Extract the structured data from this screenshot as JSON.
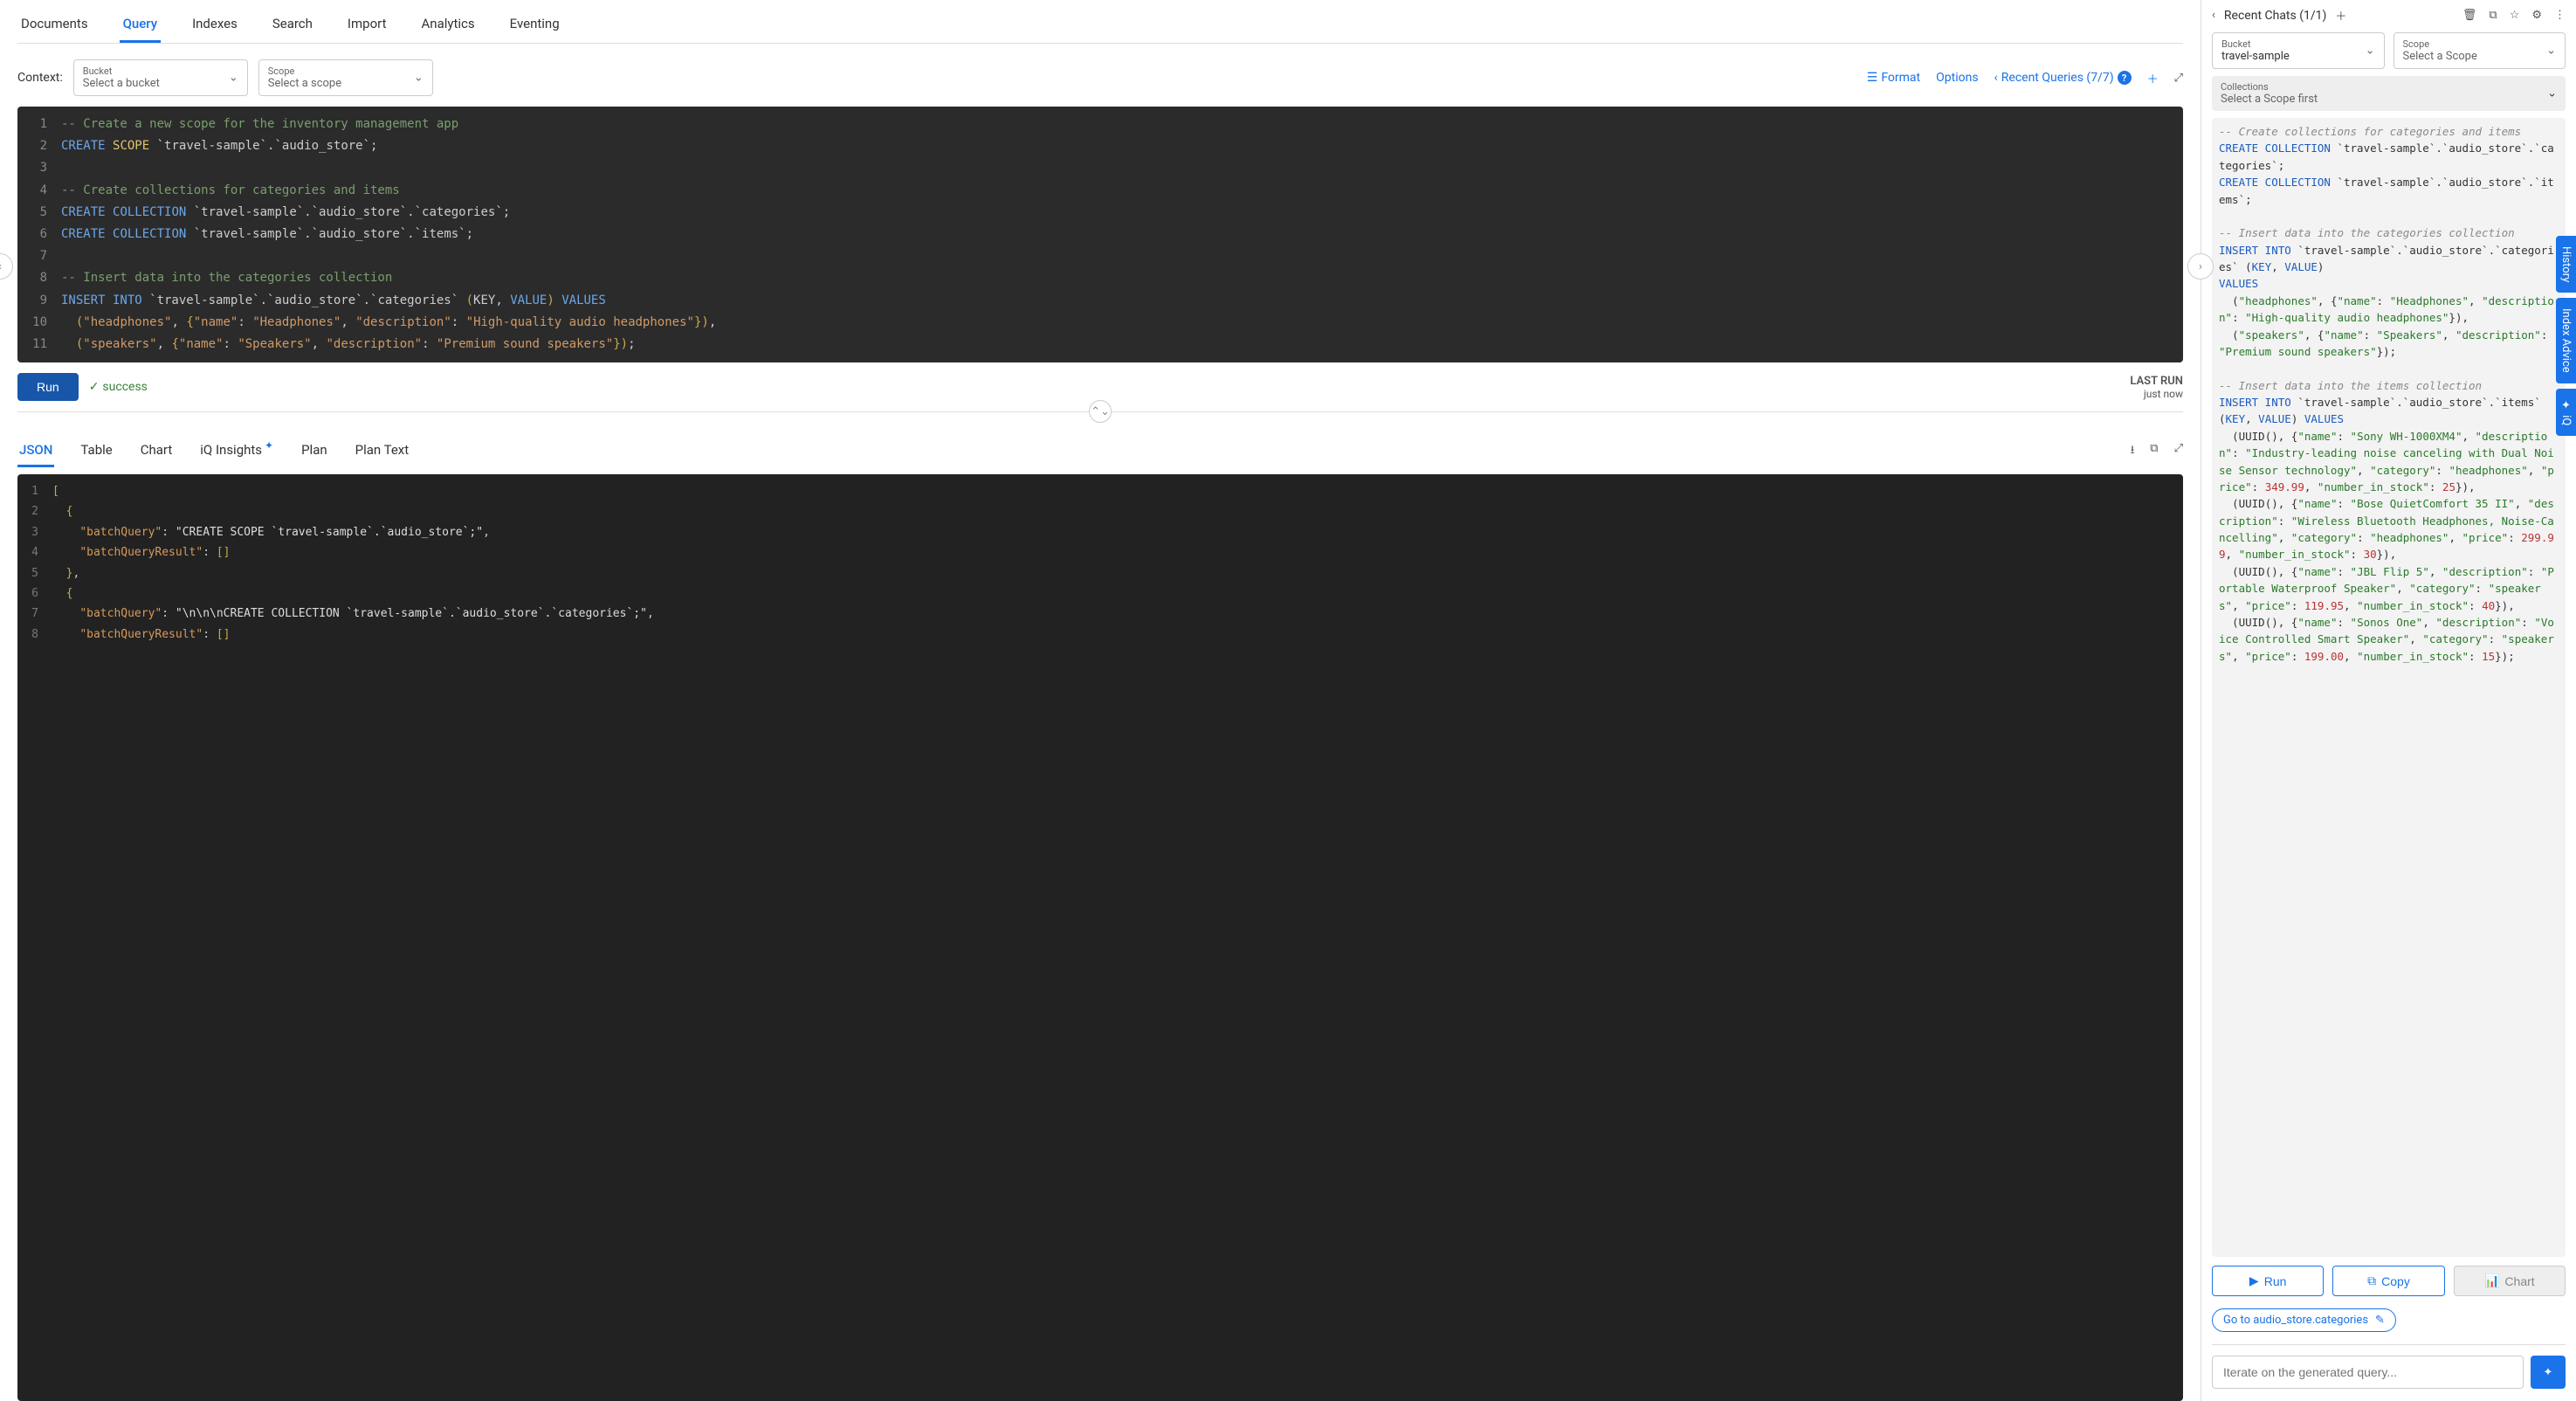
{
  "tabs": [
    "Documents",
    "Query",
    "Indexes",
    "Search",
    "Import",
    "Analytics",
    "Eventing"
  ],
  "activeTab": "Query",
  "context": {
    "label": "Context:",
    "bucket": {
      "label": "Bucket",
      "placeholder": "Select a bucket"
    },
    "scope": {
      "label": "Scope",
      "placeholder": "Select a scope"
    }
  },
  "topActions": {
    "format": "Format",
    "options": "Options",
    "recentQueries": "Recent Queries (7/7)",
    "badge": "?"
  },
  "editorLines": [
    [
      {
        "t": "comment",
        "v": "-- Create a new scope for the inventory management app"
      }
    ],
    [
      {
        "t": "keyword",
        "v": "CREATE"
      },
      {
        "t": "punc",
        "v": " "
      },
      {
        "t": "ident",
        "v": "SCOPE"
      },
      {
        "t": "punc",
        "v": " `travel-sample`.`audio_store`;"
      }
    ],
    [],
    [
      {
        "t": "comment",
        "v": "-- Create collections for categories and items"
      }
    ],
    [
      {
        "t": "keyword",
        "v": "CREATE"
      },
      {
        "t": "punc",
        "v": " "
      },
      {
        "t": "keyword",
        "v": "COLLECTION"
      },
      {
        "t": "punc",
        "v": " `travel-sample`.`audio_store`.`categories`;"
      }
    ],
    [
      {
        "t": "keyword",
        "v": "CREATE"
      },
      {
        "t": "punc",
        "v": " "
      },
      {
        "t": "keyword",
        "v": "COLLECTION"
      },
      {
        "t": "punc",
        "v": " `travel-sample`.`audio_store`.`items`;"
      }
    ],
    [],
    [
      {
        "t": "comment",
        "v": "-- Insert data into the categories collection"
      }
    ],
    [
      {
        "t": "keyword",
        "v": "INSERT INTO"
      },
      {
        "t": "punc",
        "v": " `travel-sample`.`audio_store`.`categories` "
      },
      {
        "t": "paren",
        "v": "("
      },
      {
        "t": "punc",
        "v": "KEY, "
      },
      {
        "t": "keyword",
        "v": "VALUE"
      },
      {
        "t": "paren",
        "v": ")"
      },
      {
        "t": "punc",
        "v": " "
      },
      {
        "t": "keyword",
        "v": "VALUES"
      }
    ],
    [
      {
        "t": "punc",
        "v": "  "
      },
      {
        "t": "paren",
        "v": "("
      },
      {
        "t": "string",
        "v": "\"headphones\""
      },
      {
        "t": "punc",
        "v": ", "
      },
      {
        "t": "paren",
        "v": "{"
      },
      {
        "t": "string",
        "v": "\"name\""
      },
      {
        "t": "punc",
        "v": ": "
      },
      {
        "t": "string",
        "v": "\"Headphones\""
      },
      {
        "t": "punc",
        "v": ", "
      },
      {
        "t": "string",
        "v": "\"description\""
      },
      {
        "t": "punc",
        "v": ": "
      },
      {
        "t": "string",
        "v": "\"High-quality audio headphones\""
      },
      {
        "t": "paren",
        "v": "}"
      },
      {
        "t": "paren",
        "v": ")"
      },
      {
        "t": "punc",
        "v": ","
      }
    ],
    [
      {
        "t": "punc",
        "v": "  "
      },
      {
        "t": "paren",
        "v": "("
      },
      {
        "t": "string",
        "v": "\"speakers\""
      },
      {
        "t": "punc",
        "v": ", "
      },
      {
        "t": "paren",
        "v": "{"
      },
      {
        "t": "string",
        "v": "\"name\""
      },
      {
        "t": "punc",
        "v": ": "
      },
      {
        "t": "string",
        "v": "\"Speakers\""
      },
      {
        "t": "punc",
        "v": ", "
      },
      {
        "t": "string",
        "v": "\"description\""
      },
      {
        "t": "punc",
        "v": ": "
      },
      {
        "t": "string",
        "v": "\"Premium sound speakers\""
      },
      {
        "t": "paren",
        "v": "}"
      },
      {
        "t": "paren",
        "v": ")"
      },
      {
        "t": "punc",
        "v": ";"
      }
    ]
  ],
  "run": {
    "label": "Run",
    "status": "success",
    "lastRunLabel": "LAST RUN",
    "lastRunValue": "just now"
  },
  "resultTabs": [
    "JSON",
    "Table",
    "Chart",
    "iQ Insights",
    "Plan",
    "Plan Text"
  ],
  "activeResultTab": "JSON",
  "jsonLines": [
    [
      {
        "t": "jbr",
        "v": "["
      }
    ],
    [
      {
        "t": "punc",
        "v": "  "
      },
      {
        "t": "jbr",
        "v": "{"
      }
    ],
    [
      {
        "t": "punc",
        "v": "    "
      },
      {
        "t": "key",
        "v": "\"batchQuery\""
      },
      {
        "t": "punc",
        "v": ": "
      },
      {
        "t": "jstr",
        "v": "\"CREATE SCOPE `travel-sample`.`audio_store`;\""
      },
      {
        "t": "punc",
        "v": ","
      }
    ],
    [
      {
        "t": "punc",
        "v": "    "
      },
      {
        "t": "key",
        "v": "\"batchQueryResult\""
      },
      {
        "t": "punc",
        "v": ": "
      },
      {
        "t": "jbr",
        "v": "[]"
      }
    ],
    [
      {
        "t": "punc",
        "v": "  "
      },
      {
        "t": "jbr",
        "v": "}"
      },
      {
        "t": "punc",
        "v": ","
      }
    ],
    [
      {
        "t": "punc",
        "v": "  "
      },
      {
        "t": "jbr",
        "v": "{"
      }
    ],
    [
      {
        "t": "punc",
        "v": "    "
      },
      {
        "t": "key",
        "v": "\"batchQuery\""
      },
      {
        "t": "punc",
        "v": ": "
      },
      {
        "t": "jstr",
        "v": "\"\\n\\n\\nCREATE COLLECTION `travel-sample`.`audio_store`.`categories`;\""
      },
      {
        "t": "punc",
        "v": ","
      }
    ],
    [
      {
        "t": "punc",
        "v": "    "
      },
      {
        "t": "key",
        "v": "\"batchQueryResult\""
      },
      {
        "t": "punc",
        "v": ": "
      },
      {
        "t": "jbr",
        "v": "[]"
      }
    ]
  ],
  "side": {
    "recentChats": "Recent Chats (1/1)",
    "bucket": {
      "label": "Bucket",
      "value": "travel-sample"
    },
    "scope": {
      "label": "Scope",
      "value": "Select a Scope"
    },
    "collections": {
      "label": "Collections",
      "value": "Select a Scope first"
    },
    "codeSegments": [
      {
        "t": "comment",
        "v": "-- Create collections for categories and items\n"
      },
      {
        "t": "kw",
        "v": "CREATE COLLECTION"
      },
      {
        "t": "plain",
        "v": " `travel-sample`.`audio_store`.`categories`;\n"
      },
      {
        "t": "kw",
        "v": "CREATE COLLECTION"
      },
      {
        "t": "plain",
        "v": " `travel-sample`.`audio_store`.`items`;\n\n"
      },
      {
        "t": "comment",
        "v": "-- Insert data into the categories collection\n"
      },
      {
        "t": "kw",
        "v": "INSERT INTO"
      },
      {
        "t": "plain",
        "v": " `travel-sample`.`audio_store`.`categories` ("
      },
      {
        "t": "kw",
        "v": "KEY"
      },
      {
        "t": "plain",
        "v": ", "
      },
      {
        "t": "kw",
        "v": "VALUE"
      },
      {
        "t": "plain",
        "v": ")\n"
      },
      {
        "t": "kw",
        "v": "VALUES"
      },
      {
        "t": "plain",
        "v": "\n  ("
      },
      {
        "t": "str",
        "v": "\"headphones\""
      },
      {
        "t": "plain",
        "v": ", {"
      },
      {
        "t": "str",
        "v": "\"name\""
      },
      {
        "t": "plain",
        "v": ": "
      },
      {
        "t": "str",
        "v": "\"Headphones\""
      },
      {
        "t": "plain",
        "v": ", "
      },
      {
        "t": "str",
        "v": "\"description\""
      },
      {
        "t": "plain",
        "v": ": "
      },
      {
        "t": "str",
        "v": "\"High-quality audio headphones\""
      },
      {
        "t": "plain",
        "v": "}),\n  ("
      },
      {
        "t": "str",
        "v": "\"speakers\""
      },
      {
        "t": "plain",
        "v": ", {"
      },
      {
        "t": "str",
        "v": "\"name\""
      },
      {
        "t": "plain",
        "v": ": "
      },
      {
        "t": "str",
        "v": "\"Speakers\""
      },
      {
        "t": "plain",
        "v": ", "
      },
      {
        "t": "str",
        "v": "\"description\""
      },
      {
        "t": "plain",
        "v": ": "
      },
      {
        "t": "str",
        "v": "\"Premium sound speakers\""
      },
      {
        "t": "plain",
        "v": "});\n\n"
      },
      {
        "t": "comment",
        "v": "-- Insert data into the items collection\n"
      },
      {
        "t": "kw",
        "v": "INSERT INTO"
      },
      {
        "t": "plain",
        "v": " `travel-sample`.`audio_store`.`items` ("
      },
      {
        "t": "kw",
        "v": "KEY"
      },
      {
        "t": "plain",
        "v": ", "
      },
      {
        "t": "kw",
        "v": "VALUE"
      },
      {
        "t": "plain",
        "v": ") "
      },
      {
        "t": "kw",
        "v": "VALUES"
      },
      {
        "t": "plain",
        "v": "\n  (UUID(), {"
      },
      {
        "t": "str",
        "v": "\"name\""
      },
      {
        "t": "plain",
        "v": ": "
      },
      {
        "t": "str",
        "v": "\"Sony WH-1000XM4\""
      },
      {
        "t": "plain",
        "v": ", "
      },
      {
        "t": "str",
        "v": "\"description\""
      },
      {
        "t": "plain",
        "v": ": "
      },
      {
        "t": "str",
        "v": "\"Industry-leading noise canceling with Dual Noise Sensor technology\""
      },
      {
        "t": "plain",
        "v": ", "
      },
      {
        "t": "str",
        "v": "\"category\""
      },
      {
        "t": "plain",
        "v": ": "
      },
      {
        "t": "str",
        "v": "\"headphones\""
      },
      {
        "t": "plain",
        "v": ", "
      },
      {
        "t": "str",
        "v": "\"price\""
      },
      {
        "t": "plain",
        "v": ": "
      },
      {
        "t": "num",
        "v": "349.99"
      },
      {
        "t": "plain",
        "v": ", "
      },
      {
        "t": "str",
        "v": "\"number_in_stock\""
      },
      {
        "t": "plain",
        "v": ": "
      },
      {
        "t": "num",
        "v": "25"
      },
      {
        "t": "plain",
        "v": "}),\n  (UUID(), {"
      },
      {
        "t": "str",
        "v": "\"name\""
      },
      {
        "t": "plain",
        "v": ": "
      },
      {
        "t": "str",
        "v": "\"Bose QuietComfort 35 II\""
      },
      {
        "t": "plain",
        "v": ", "
      },
      {
        "t": "str",
        "v": "\"description\""
      },
      {
        "t": "plain",
        "v": ": "
      },
      {
        "t": "str",
        "v": "\"Wireless Bluetooth Headphones, Noise-Cancelling\""
      },
      {
        "t": "plain",
        "v": ", "
      },
      {
        "t": "str",
        "v": "\"category\""
      },
      {
        "t": "plain",
        "v": ": "
      },
      {
        "t": "str",
        "v": "\"headphones\""
      },
      {
        "t": "plain",
        "v": ", "
      },
      {
        "t": "str",
        "v": "\"price\""
      },
      {
        "t": "plain",
        "v": ": "
      },
      {
        "t": "num",
        "v": "299.99"
      },
      {
        "t": "plain",
        "v": ", "
      },
      {
        "t": "str",
        "v": "\"number_in_stock\""
      },
      {
        "t": "plain",
        "v": ": "
      },
      {
        "t": "num",
        "v": "30"
      },
      {
        "t": "plain",
        "v": "}),\n  (UUID(), {"
      },
      {
        "t": "str",
        "v": "\"name\""
      },
      {
        "t": "plain",
        "v": ": "
      },
      {
        "t": "str",
        "v": "\"JBL Flip 5\""
      },
      {
        "t": "plain",
        "v": ", "
      },
      {
        "t": "str",
        "v": "\"description\""
      },
      {
        "t": "plain",
        "v": ": "
      },
      {
        "t": "str",
        "v": "\"Portable Waterproof Speaker\""
      },
      {
        "t": "plain",
        "v": ", "
      },
      {
        "t": "str",
        "v": "\"category\""
      },
      {
        "t": "plain",
        "v": ": "
      },
      {
        "t": "str",
        "v": "\"speakers\""
      },
      {
        "t": "plain",
        "v": ", "
      },
      {
        "t": "str",
        "v": "\"price\""
      },
      {
        "t": "plain",
        "v": ": "
      },
      {
        "t": "num",
        "v": "119.95"
      },
      {
        "t": "plain",
        "v": ", "
      },
      {
        "t": "str",
        "v": "\"number_in_stock\""
      },
      {
        "t": "plain",
        "v": ": "
      },
      {
        "t": "num",
        "v": "40"
      },
      {
        "t": "plain",
        "v": "}),\n  (UUID(), {"
      },
      {
        "t": "str",
        "v": "\"name\""
      },
      {
        "t": "plain",
        "v": ": "
      },
      {
        "t": "str",
        "v": "\"Sonos One\""
      },
      {
        "t": "plain",
        "v": ", "
      },
      {
        "t": "str",
        "v": "\"description\""
      },
      {
        "t": "plain",
        "v": ": "
      },
      {
        "t": "str",
        "v": "\"Voice Controlled Smart Speaker\""
      },
      {
        "t": "plain",
        "v": ", "
      },
      {
        "t": "str",
        "v": "\"category\""
      },
      {
        "t": "plain",
        "v": ": "
      },
      {
        "t": "str",
        "v": "\"speakers\""
      },
      {
        "t": "plain",
        "v": ", "
      },
      {
        "t": "str",
        "v": "\"price\""
      },
      {
        "t": "plain",
        "v": ": "
      },
      {
        "t": "num",
        "v": "199.00"
      },
      {
        "t": "plain",
        "v": ", "
      },
      {
        "t": "str",
        "v": "\"number_in_stock\""
      },
      {
        "t": "plain",
        "v": ": "
      },
      {
        "t": "num",
        "v": "15"
      },
      {
        "t": "plain",
        "v": "});"
      }
    ],
    "buttons": {
      "run": "Run",
      "copy": "Copy",
      "chart": "Chart"
    },
    "chip": "Go to audio_store.categories",
    "inputPlaceholder": "Iterate on the generated query..."
  },
  "rail": [
    "History",
    "Index Advice",
    "✦ iQ"
  ]
}
